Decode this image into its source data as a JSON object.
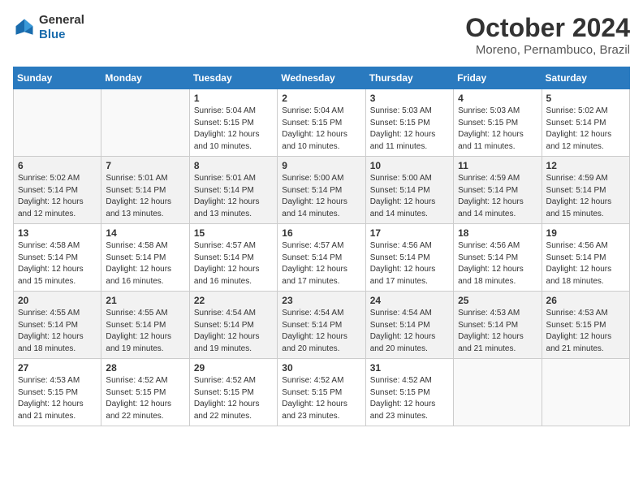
{
  "header": {
    "logo": {
      "general": "General",
      "blue": "Blue"
    },
    "month": "October 2024",
    "location": "Moreno, Pernambuco, Brazil"
  },
  "weekdays": [
    "Sunday",
    "Monday",
    "Tuesday",
    "Wednesday",
    "Thursday",
    "Friday",
    "Saturday"
  ],
  "weeks": [
    [
      {
        "day": null
      },
      {
        "day": null
      },
      {
        "day": 1,
        "sunrise": "5:04 AM",
        "sunset": "5:15 PM",
        "daylight": "12 hours and 10 minutes."
      },
      {
        "day": 2,
        "sunrise": "5:04 AM",
        "sunset": "5:15 PM",
        "daylight": "12 hours and 10 minutes."
      },
      {
        "day": 3,
        "sunrise": "5:03 AM",
        "sunset": "5:15 PM",
        "daylight": "12 hours and 11 minutes."
      },
      {
        "day": 4,
        "sunrise": "5:03 AM",
        "sunset": "5:15 PM",
        "daylight": "12 hours and 11 minutes."
      },
      {
        "day": 5,
        "sunrise": "5:02 AM",
        "sunset": "5:14 PM",
        "daylight": "12 hours and 12 minutes."
      }
    ],
    [
      {
        "day": 6,
        "sunrise": "5:02 AM",
        "sunset": "5:14 PM",
        "daylight": "12 hours and 12 minutes."
      },
      {
        "day": 7,
        "sunrise": "5:01 AM",
        "sunset": "5:14 PM",
        "daylight": "12 hours and 13 minutes."
      },
      {
        "day": 8,
        "sunrise": "5:01 AM",
        "sunset": "5:14 PM",
        "daylight": "12 hours and 13 minutes."
      },
      {
        "day": 9,
        "sunrise": "5:00 AM",
        "sunset": "5:14 PM",
        "daylight": "12 hours and 14 minutes."
      },
      {
        "day": 10,
        "sunrise": "5:00 AM",
        "sunset": "5:14 PM",
        "daylight": "12 hours and 14 minutes."
      },
      {
        "day": 11,
        "sunrise": "4:59 AM",
        "sunset": "5:14 PM",
        "daylight": "12 hours and 14 minutes."
      },
      {
        "day": 12,
        "sunrise": "4:59 AM",
        "sunset": "5:14 PM",
        "daylight": "12 hours and 15 minutes."
      }
    ],
    [
      {
        "day": 13,
        "sunrise": "4:58 AM",
        "sunset": "5:14 PM",
        "daylight": "12 hours and 15 minutes."
      },
      {
        "day": 14,
        "sunrise": "4:58 AM",
        "sunset": "5:14 PM",
        "daylight": "12 hours and 16 minutes."
      },
      {
        "day": 15,
        "sunrise": "4:57 AM",
        "sunset": "5:14 PM",
        "daylight": "12 hours and 16 minutes."
      },
      {
        "day": 16,
        "sunrise": "4:57 AM",
        "sunset": "5:14 PM",
        "daylight": "12 hours and 17 minutes."
      },
      {
        "day": 17,
        "sunrise": "4:56 AM",
        "sunset": "5:14 PM",
        "daylight": "12 hours and 17 minutes."
      },
      {
        "day": 18,
        "sunrise": "4:56 AM",
        "sunset": "5:14 PM",
        "daylight": "12 hours and 18 minutes."
      },
      {
        "day": 19,
        "sunrise": "4:56 AM",
        "sunset": "5:14 PM",
        "daylight": "12 hours and 18 minutes."
      }
    ],
    [
      {
        "day": 20,
        "sunrise": "4:55 AM",
        "sunset": "5:14 PM",
        "daylight": "12 hours and 18 minutes."
      },
      {
        "day": 21,
        "sunrise": "4:55 AM",
        "sunset": "5:14 PM",
        "daylight": "12 hours and 19 minutes."
      },
      {
        "day": 22,
        "sunrise": "4:54 AM",
        "sunset": "5:14 PM",
        "daylight": "12 hours and 19 minutes."
      },
      {
        "day": 23,
        "sunrise": "4:54 AM",
        "sunset": "5:14 PM",
        "daylight": "12 hours and 20 minutes."
      },
      {
        "day": 24,
        "sunrise": "4:54 AM",
        "sunset": "5:14 PM",
        "daylight": "12 hours and 20 minutes."
      },
      {
        "day": 25,
        "sunrise": "4:53 AM",
        "sunset": "5:14 PM",
        "daylight": "12 hours and 21 minutes."
      },
      {
        "day": 26,
        "sunrise": "4:53 AM",
        "sunset": "5:15 PM",
        "daylight": "12 hours and 21 minutes."
      }
    ],
    [
      {
        "day": 27,
        "sunrise": "4:53 AM",
        "sunset": "5:15 PM",
        "daylight": "12 hours and 21 minutes."
      },
      {
        "day": 28,
        "sunrise": "4:52 AM",
        "sunset": "5:15 PM",
        "daylight": "12 hours and 22 minutes."
      },
      {
        "day": 29,
        "sunrise": "4:52 AM",
        "sunset": "5:15 PM",
        "daylight": "12 hours and 22 minutes."
      },
      {
        "day": 30,
        "sunrise": "4:52 AM",
        "sunset": "5:15 PM",
        "daylight": "12 hours and 23 minutes."
      },
      {
        "day": 31,
        "sunrise": "4:52 AM",
        "sunset": "5:15 PM",
        "daylight": "12 hours and 23 minutes."
      },
      {
        "day": null
      },
      {
        "day": null
      }
    ]
  ]
}
